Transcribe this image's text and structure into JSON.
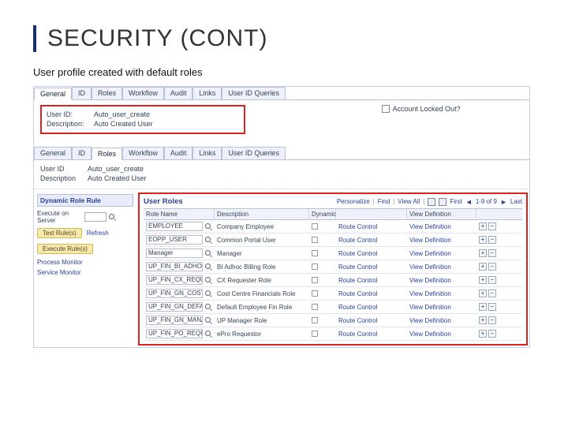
{
  "title": "SECURITY (CONT)",
  "subtitle": "User profile created with default roles",
  "tabs": [
    "General",
    "ID",
    "Roles",
    "Workflow",
    "Audit",
    "Links",
    "User ID Queries"
  ],
  "active_tab": 0,
  "form1": {
    "user_id_label": "User ID:",
    "user_id_value": "Auto_user_create",
    "desc_label": "Description:",
    "desc_value": "Auto Created User"
  },
  "account_locked": {
    "label": "Account Locked Out?"
  },
  "tabs2_active": 2,
  "form2": {
    "user_id_label": "User ID",
    "user_id_value": "Auto_user_create",
    "desc_label": "Description",
    "desc_value": "Auto Created User"
  },
  "left": {
    "header": "Dynamic Role Rule",
    "exec_label": "Execute on Server",
    "test_rules": "Test Rule(s)",
    "refresh": "Refresh",
    "exec_rules": "Execute Rule(s)",
    "proc_monitor": "Process Monitor",
    "svc_monitor": "Service Monitor"
  },
  "roles_panel": {
    "title": "User Roles",
    "personalize": "Personalize",
    "find": "Find",
    "view_all": "View All",
    "first": "First",
    "range": "1-9 of 9",
    "last": "Last",
    "columns": [
      "Role Name",
      "Description",
      "Dynamic",
      "",
      "",
      ""
    ],
    "view_def": "View Definition",
    "rows": [
      {
        "name": "EMPLOYEE",
        "desc": "Company Employee",
        "route": "Route Control"
      },
      {
        "name": "EOPP_USER",
        "desc": "Common Portal User",
        "route": "Route Control"
      },
      {
        "name": "Manager",
        "desc": "Manager",
        "route": "Route Control"
      },
      {
        "name": "UP_FIN_BI_ADHOC_R",
        "desc": "BI Adhoc Billing Role",
        "route": "Route Control"
      },
      {
        "name": "UP_FIN_CX_REQUEST",
        "desc": "CX Requester Role",
        "route": "Route Control"
      },
      {
        "name": "UP_FIN_GN_COSTCVI",
        "desc": "Cost Centre Financials Role",
        "route": "Route Control"
      },
      {
        "name": "UP_FIN_GN_DEFAULT",
        "desc": "Default Employee Fin Role",
        "route": "Route Control"
      },
      {
        "name": "UP_FIN_GN_MANAGE",
        "desc": "UP Manager Role",
        "route": "Route Control"
      },
      {
        "name": "UP_FIN_PO_REQUEST",
        "desc": "ePro Requestor",
        "route": "Route Control"
      }
    ]
  }
}
